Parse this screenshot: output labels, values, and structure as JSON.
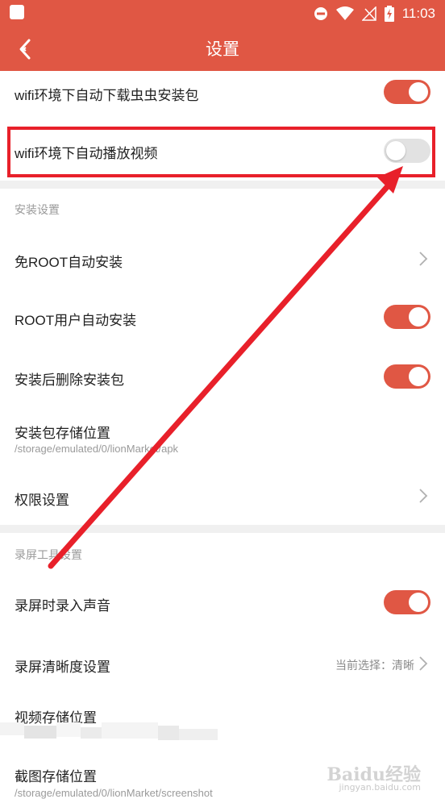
{
  "status": {
    "time": "11:03"
  },
  "appbar": {
    "title": "设置"
  },
  "rows": {
    "auto_download": {
      "label": "wifi环境下自动下载虫虫安装包",
      "toggle_on": true
    },
    "auto_play": {
      "label": "wifi环境下自动播放视频",
      "toggle_on": false
    },
    "install_header": "安装设置",
    "no_root_install": {
      "label": "免ROOT自动安装"
    },
    "root_install": {
      "label": "ROOT用户自动安装",
      "toggle_on": true
    },
    "delete_after_install": {
      "label": "安装后删除安装包",
      "toggle_on": true
    },
    "storage_location": {
      "label": "安装包存储位置",
      "path": "/storage/emulated/0/lionMarket/apk"
    },
    "permissions": {
      "label": "权限设置"
    },
    "record_header": "录屏工具设置",
    "record_audio": {
      "label": "录屏时录入声音",
      "toggle_on": true
    },
    "record_quality": {
      "label": "录屏清晰度设置",
      "value": "当前选择：清晰"
    },
    "video_storage": {
      "label": "视频存储位置"
    },
    "screenshot_storage": {
      "label": "截图存储位置",
      "path": "/storage/emulated/0/lionMarket/screenshot"
    }
  },
  "watermark": {
    "text": "Baidu经验",
    "sub": "jingyan.baidu.com"
  },
  "colors": {
    "accent": "#e05744",
    "highlight": "#e8202a",
    "toggle_off": "#e2e2e2"
  }
}
